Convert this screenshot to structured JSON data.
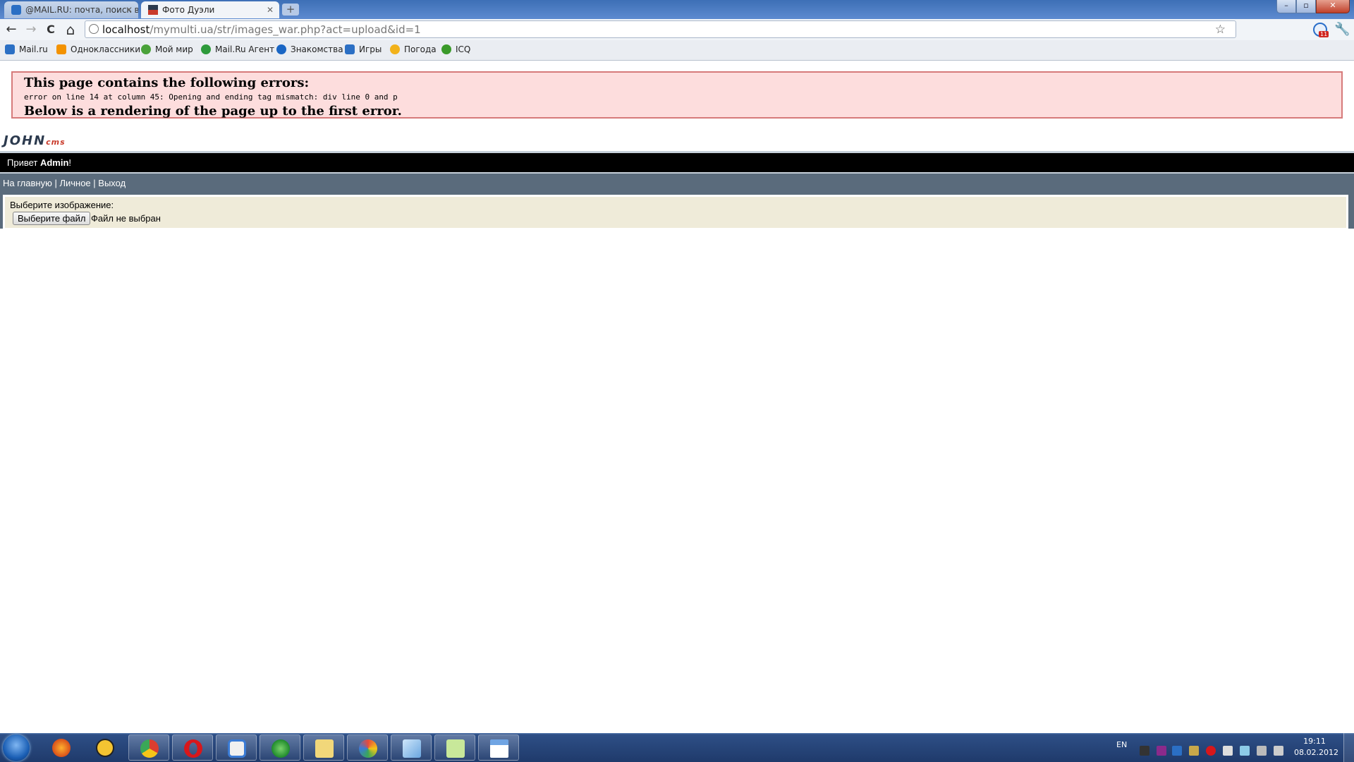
{
  "tabs": [
    {
      "title": "@MAIL.RU: почта, поиск в",
      "active": false,
      "icon": "mailru-icon"
    },
    {
      "title": "Фото Дуэли",
      "active": true,
      "icon": "johncms-favicon"
    }
  ],
  "newtab_label": "+",
  "window_controls": {
    "minimize": "–",
    "maximize": "▫",
    "close": "✕"
  },
  "toolbar": {
    "back": "←",
    "forward": "→",
    "reload": "C",
    "home": "⌂"
  },
  "address": {
    "host": "localhost",
    "path": "/mymulti.ua/str/images_war.php?act=upload&id=1"
  },
  "extension_badge": "11",
  "bookmarks": [
    {
      "label": "Mail.ru",
      "icon": "mailru-icon",
      "color": "#2b6fc4"
    },
    {
      "label": "Одноклассники",
      "icon": "odnoklassniki-icon",
      "color": "#f39200"
    },
    {
      "label": "Мой мир",
      "icon": "moymir-icon",
      "color": "#4aa23a"
    },
    {
      "label": "Mail.Ru Агент",
      "icon": "agent-icon",
      "color": "#2e9a3b"
    },
    {
      "label": "Знакомства",
      "icon": "dating-icon",
      "color": "#1a66c4"
    },
    {
      "label": "Игры",
      "icon": "games-icon",
      "color": "#2b6fc4"
    },
    {
      "label": "Погода",
      "icon": "weather-icon",
      "color": "#f2b21a"
    },
    {
      "label": "ICQ",
      "icon": "icq-icon",
      "color": "#3a9a2a"
    }
  ],
  "error": {
    "heading": "This page contains the following errors:",
    "message": "error on line 14 at column 45: Opening and ending tag mismatch: div line 0 and p",
    "footer": "Below is a rendering of the page up to the first error."
  },
  "logo": {
    "part1": "JOHN",
    "part2": "cms"
  },
  "greeting": {
    "prefix": "Привет ",
    "user": "Admin",
    "suffix": "!"
  },
  "menu": {
    "home": "На главную",
    "sep": " | ",
    "personal": "Личное",
    "logout": "Выход"
  },
  "upload": {
    "label": "Выберите изображение:",
    "button": "Выберите файл",
    "status": "Файл не выбран"
  },
  "taskbar": {
    "apps": [
      "firefox",
      "atom",
      "chrome",
      "opera",
      "files",
      "ie",
      "explorer",
      "paint",
      "notepad",
      "editor",
      "window"
    ],
    "lang": "EN",
    "time": "19:11",
    "date": "08.02.2012"
  }
}
